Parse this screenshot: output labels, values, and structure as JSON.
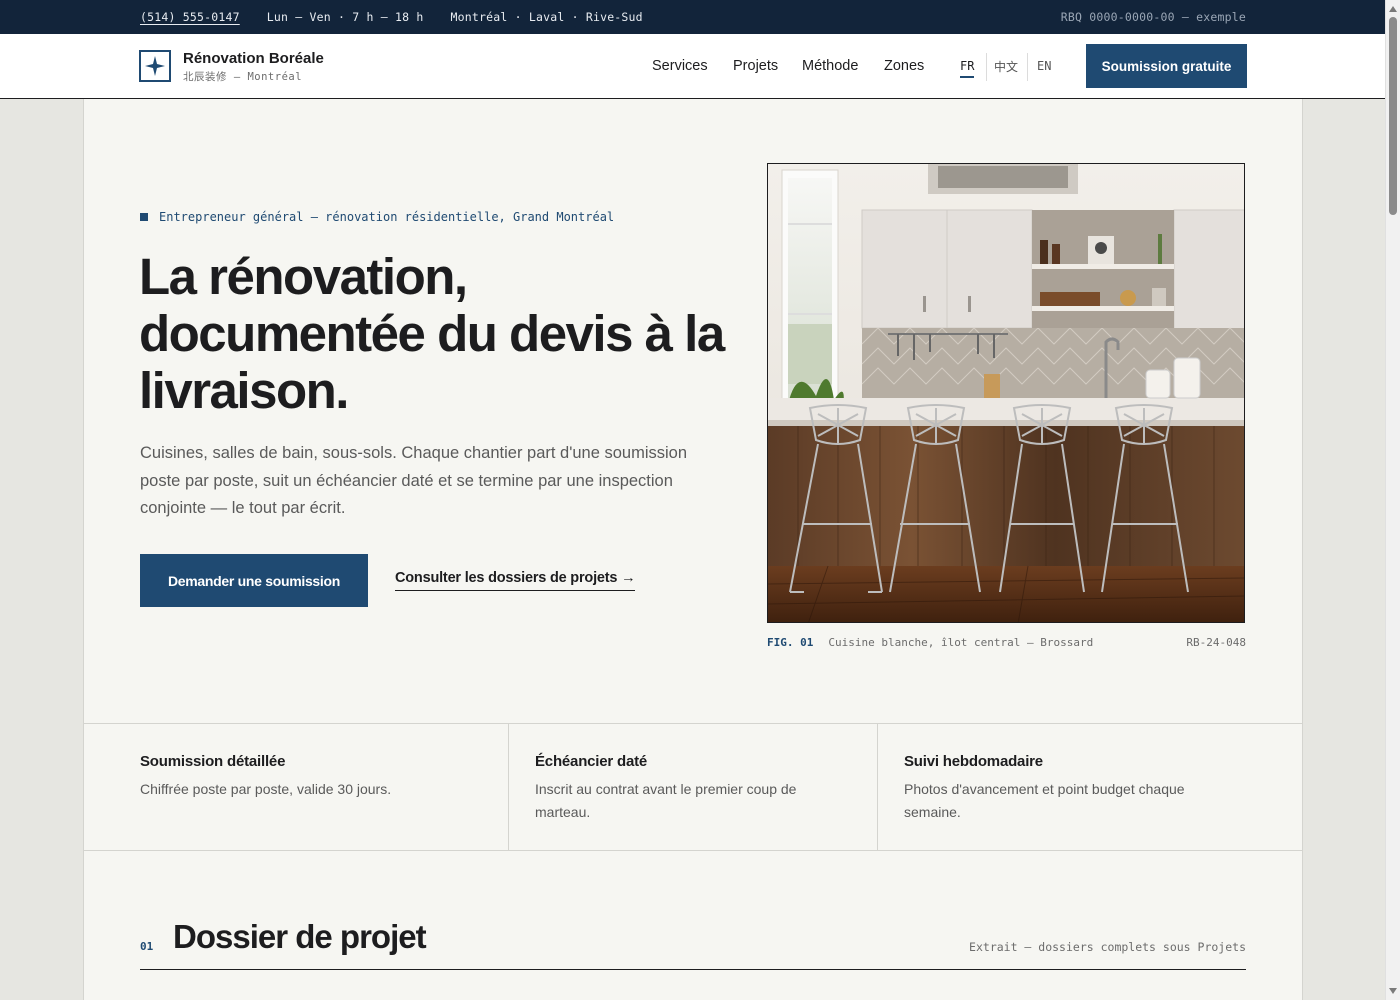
{
  "topbar": {
    "phone": "(514) 555-0147",
    "hours": "Lun – Ven · 7 h – 18 h",
    "zones": "Montréal · Laval · Rive-Sud",
    "rbq": "RBQ 0000-0000-00 — exemple"
  },
  "header": {
    "brand_name": "Rénovation Boréale",
    "brand_sub": "北辰装修 — Montréal",
    "logo_icon": "four-point-star-icon",
    "nav": [
      "Services",
      "Projets",
      "Méthode",
      "Zones"
    ],
    "languages": [
      {
        "label": "FR",
        "active": true
      },
      {
        "label": "中文",
        "active": false
      },
      {
        "label": "EN",
        "active": false
      }
    ],
    "cta": "Soumission gratuite"
  },
  "hero": {
    "eyebrow": "Entrepreneur général — rénovation résidentielle, Grand Montréal",
    "title": "La rénovation, documentée du devis à la livraison.",
    "description": "Cuisines, salles de bain, sous-sols. Chaque chantier part d'une soumission poste par poste, suit un échéancier daté et se termine par une inspection conjointe — le tout par écrit.",
    "primary_button": "Demander une soumission",
    "secondary_link": "Consulter les dossiers de projets →"
  },
  "figure": {
    "number": "FIG. 01",
    "caption": "Cuisine blanche, îlot central — Brossard",
    "reference": "RB-24-048"
  },
  "features": [
    {
      "title": "Soumission détaillée",
      "description": "Chiffrée poste par poste, valide 30 jours."
    },
    {
      "title": "Échéancier daté",
      "description": "Inscrit au contrat avant le premier coup de marteau."
    },
    {
      "title": "Suivi hebdomadaire",
      "description": "Photos d'avancement et point budget chaque semaine."
    }
  ],
  "section": {
    "number": "01",
    "title": "Dossier de projet",
    "note": "Extrait — dossiers complets sous Projets"
  },
  "colors": {
    "navy": "#12243a",
    "accent": "#1f4a72",
    "paper": "#f6f6f2",
    "ink": "#1d1d1f"
  }
}
